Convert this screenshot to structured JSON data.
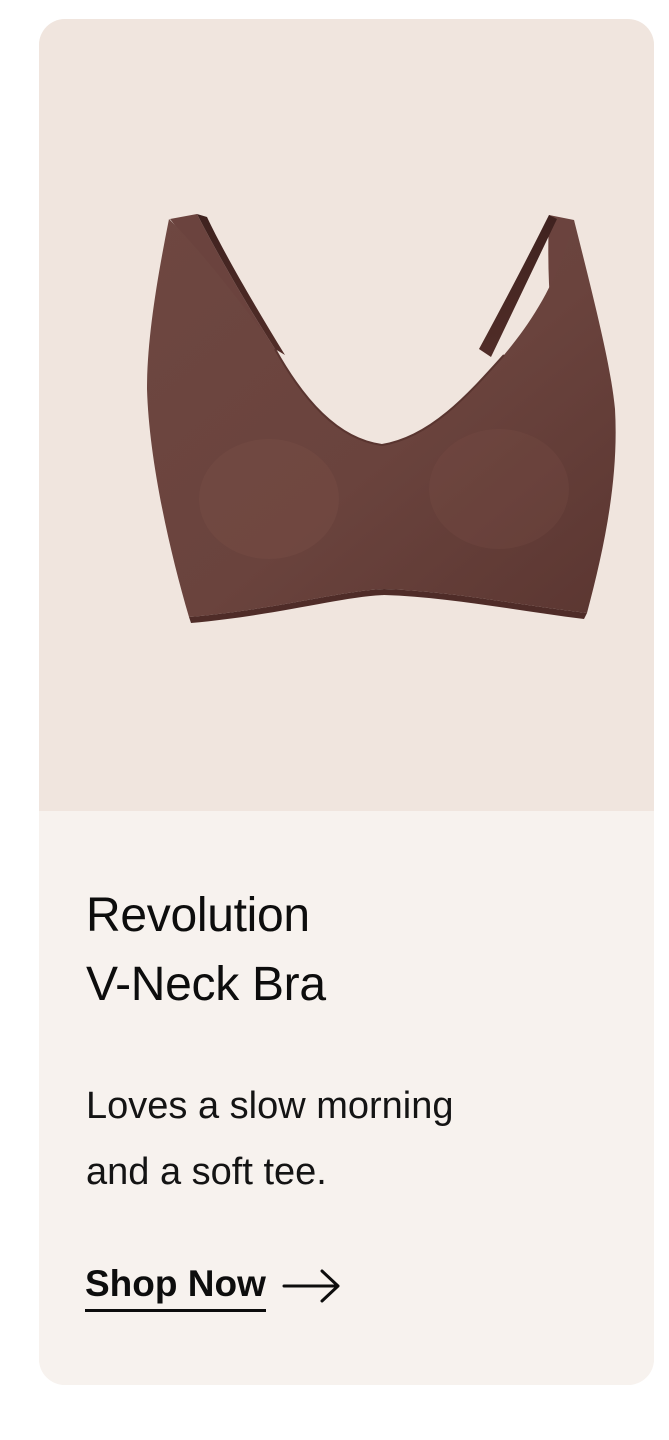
{
  "product": {
    "name_line1": "Revolution",
    "name_line2": "V-Neck Bra",
    "description_line1": "Loves a slow morning",
    "description_line2": "and a soft tee.",
    "cta_label": "Shop Now",
    "cta_icon": "arrow-right-icon",
    "image_icon": "bra-product-image"
  },
  "colors": {
    "image_background": "#f0e5de",
    "card_background": "#f7f2ee",
    "product_color": "#6a423c",
    "text": "#0d0d0d"
  }
}
